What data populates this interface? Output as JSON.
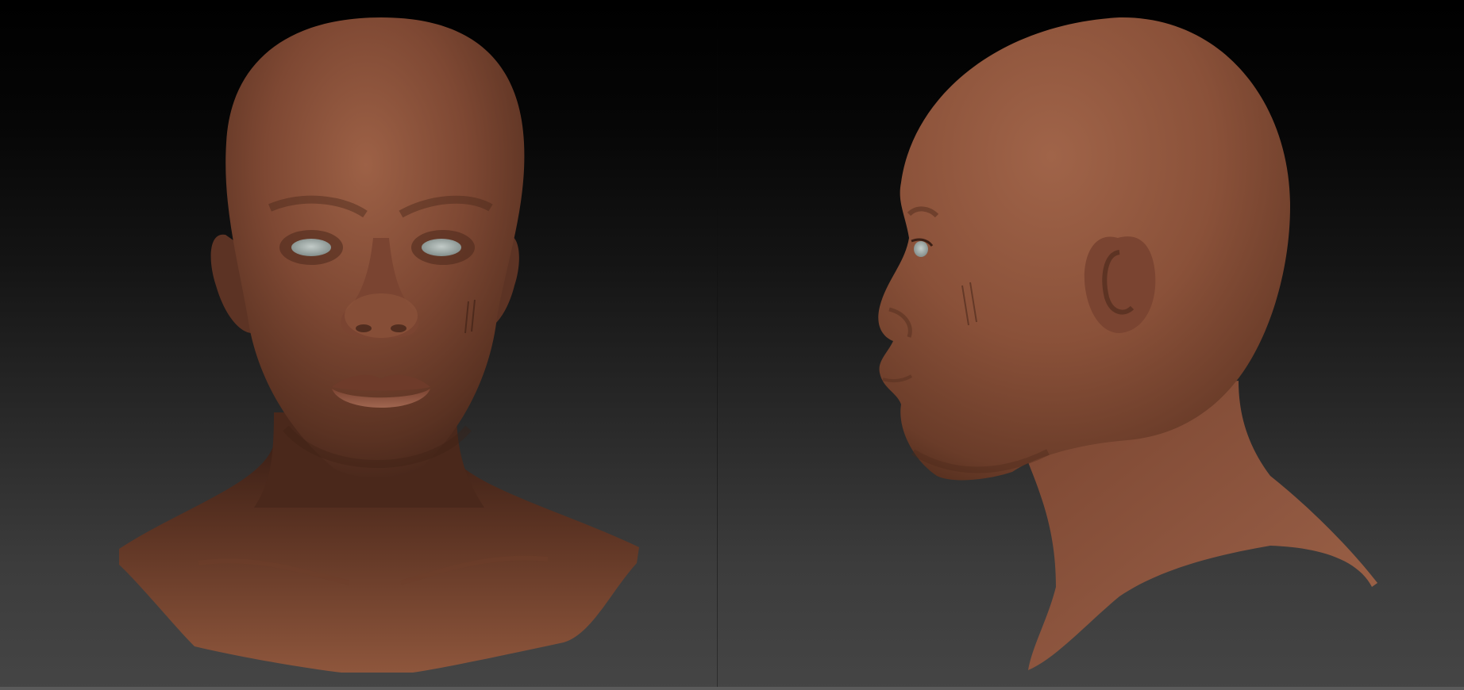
{
  "views": [
    {
      "view": "front",
      "icon": "front-head-render"
    },
    {
      "view": "side",
      "icon": "side-head-render"
    }
  ],
  "colors": {
    "skin_light": "#9a5f44",
    "skin_mid": "#7b4632",
    "skin_dark": "#4e2a1d",
    "skin_shadow": "#341b12",
    "eye": "#a7b1ae",
    "background_top": "#000000",
    "background_bottom": "#454545"
  }
}
